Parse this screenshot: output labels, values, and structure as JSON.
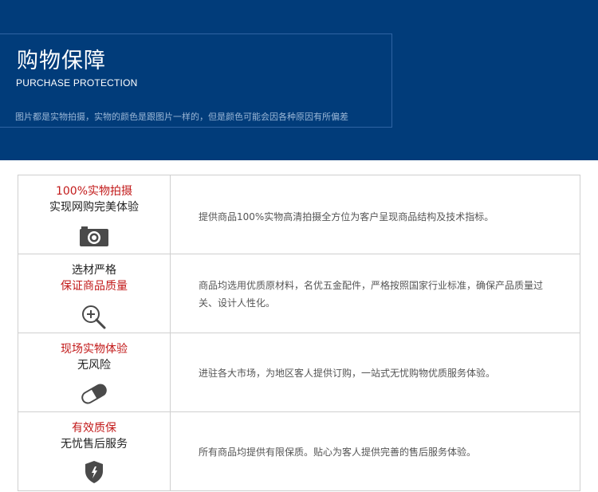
{
  "banner": {
    "title_cn": "购物保障",
    "title_en": "PURCHASE PROTECTION",
    "note": "图片都是实物拍摄，实物的颜色是跟图片一样的，但是颜色可能会因各种原因有所偏差"
  },
  "rows": [
    {
      "line1": "100%实物拍摄",
      "line2": "实现网购完美体验",
      "icon": "camera-icon",
      "desc": "提供商品100%实物高清拍摄全方位为客户呈现商品结构及技术指标。"
    },
    {
      "line1": "选材严格",
      "line2": "保证商品质量",
      "icon": "magnifier-plus-icon",
      "desc": "商品均选用优质原材料，名优五金配件，严格按照国家行业标准，确保产品质量过关、设计人性化。"
    },
    {
      "line1": "现场实物体验",
      "line2": "无风险",
      "icon": "pill-icon",
      "desc": "进驻各大市场，为地区客人提供订购，一站式无忧购物优质服务体验。"
    },
    {
      "line1": "有效质保",
      "line2": "无忧售后服务",
      "icon": "shield-icon",
      "desc": "所有商品均提供有限保质。贴心为客人提供完善的售后服务体验。"
    }
  ],
  "colors": {
    "banner_bg": "#013c7a",
    "accent_red": "#c21a1a",
    "icon_gray": "#4a4a4a"
  }
}
